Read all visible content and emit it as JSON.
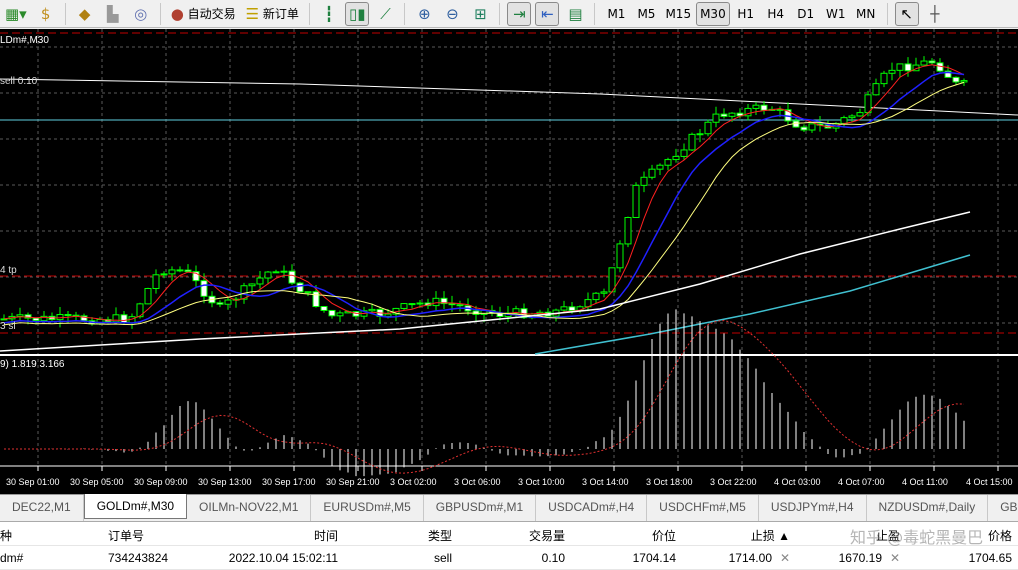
{
  "toolbar": {
    "buttons": [
      {
        "icon": "new-chart-icon"
      },
      {
        "icon": "profiles-icon"
      },
      {
        "icon": "market-watch-icon"
      },
      {
        "icon": "navigator-icon"
      },
      {
        "icon": "signals-icon"
      }
    ],
    "auto_trading": "自动交易",
    "new_order": "新订单",
    "timeframes": [
      "M1",
      "M5",
      "M15",
      "M30",
      "H1",
      "H4",
      "D1",
      "W1",
      "MN"
    ],
    "selected_timeframe": "M30"
  },
  "chart": {
    "symbol_label": "LDm#,M30",
    "sell_label": "sell 0.10",
    "tp_label": "4 tp",
    "sl_label": "3 sl",
    "indicator_label": "9) 1.819 3.166",
    "time_labels": [
      "30 Sep 01:00",
      "30 Sep 05:00",
      "30 Sep 09:00",
      "30 Sep 13:00",
      "30 Sep 17:00",
      "30 Sep 21:00",
      "3 Oct 02:00",
      "3 Oct 06:00",
      "3 Oct 10:00",
      "3 Oct 14:00",
      "3 Oct 18:00",
      "3 Oct 22:00",
      "4 Oct 03:00",
      "4 Oct 07:00",
      "4 Oct 11:00",
      "4 Oct 15:00"
    ],
    "colors": {
      "background": "#000000",
      "bull": "#00ff00",
      "bear_body": "#ffffff",
      "grid": "#5a5a5a",
      "level": "#c00000",
      "ma_fast": "#ff2020",
      "ma_mid": "#2020ff",
      "ma_slow": "#ffff80",
      "ma_long": "#ffffff",
      "ma_cyan": "#40c0d0"
    }
  },
  "tabs": [
    "DEC22,M1",
    "GOLDm#,M30",
    "OILMn-NOV22,M1",
    "EURUSDm#,M5",
    "GBPUSDm#,M1",
    "USDCADm#,H4",
    "USDCHFm#,M5",
    "USDJPYm#,H4",
    "NZDUSDm#,Daily",
    "GBI"
  ],
  "active_tab": "GOLDm#,M30",
  "table": {
    "headers": [
      "种",
      "订单号",
      "时间",
      "类型",
      "交易量",
      "价位",
      "止损 ▲",
      "止盈",
      "价格"
    ],
    "rows": [
      {
        "symbol": "dm#",
        "order": "734243824",
        "time": "2022.10.04 15:02:11",
        "type": "sell",
        "volume": "0.10",
        "price": "1704.14",
        "sl": "1714.00",
        "tp": "1670.19",
        "current": "1704.65"
      }
    ]
  },
  "watermark": "知乎 @毒蛇黑曼巴"
}
